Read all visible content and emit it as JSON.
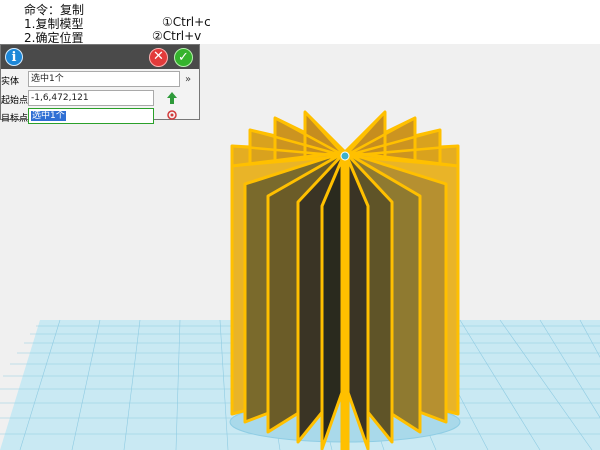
{
  "instructions": {
    "command": "命令：复制",
    "step1": "1.复制模型",
    "step1_shortcut": "①Ctrl+c",
    "step2": "2.确定位置",
    "step2_shortcut": "②Ctrl+v"
  },
  "panel": {
    "entity_label": "实体",
    "entity_value": "选中1个",
    "start_label": "起始点",
    "start_value": "-1,6,472,121",
    "target_label": "目标点",
    "target_value": "选中1个"
  },
  "colors": {
    "fin_fill": "#e4ad22",
    "fin_edge": "#ffc000",
    "fin_dark": "#2a2a1e",
    "grid_fill": "#c7e8f2",
    "grid_line": "#7fc3de"
  },
  "icons": {
    "info": "info-icon",
    "close": "close-icon",
    "confirm": "check-icon",
    "dropdown": "chevron-double-down-icon",
    "pick_start": "pick-point-icon",
    "pick_target": "target-point-icon"
  }
}
